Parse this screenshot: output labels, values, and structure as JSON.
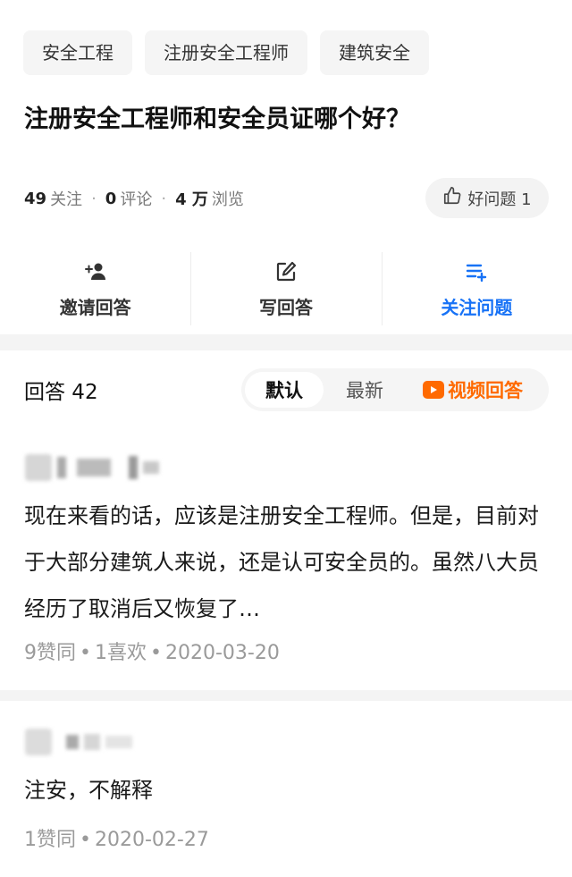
{
  "tags": [
    "安全工程",
    "注册安全工程师",
    "建筑安全"
  ],
  "question": {
    "title": "注册安全工程师和安全员证哪个好？",
    "follow_count": "49",
    "follow_label": "关注",
    "comment_count": "0",
    "comment_label": "评论",
    "view_count": "4 万",
    "view_label": "浏览",
    "good_question_label": "好问题 1"
  },
  "actions": {
    "invite_label": "邀请回答",
    "write_label": "写回答",
    "follow_label": "关注问题"
  },
  "answers_header": {
    "count_label": "回答 42",
    "sort_default": "默认",
    "sort_latest": "最新",
    "sort_video": "视频回答"
  },
  "answers": [
    {
      "text": "现在来看的话，应该是注册安全工程师。但是，目前对于大部分建筑人来说，还是认可安全员的。虽然八大员经历了取消后又恢复了…",
      "likes": "9赞同",
      "favs": "1喜欢",
      "date": "2020-03-20"
    },
    {
      "text": "注安，不解释",
      "likes": "1赞同",
      "date": "2020-02-27"
    }
  ],
  "colors": {
    "accent": "#1772f6",
    "video": "#ff6a00",
    "muted": "#9a9a9a"
  },
  "icons": {
    "good_question": "thumbs-up-icon",
    "invite": "add-person-icon",
    "write": "edit-icon",
    "follow": "list-add-icon",
    "video": "play-icon"
  }
}
